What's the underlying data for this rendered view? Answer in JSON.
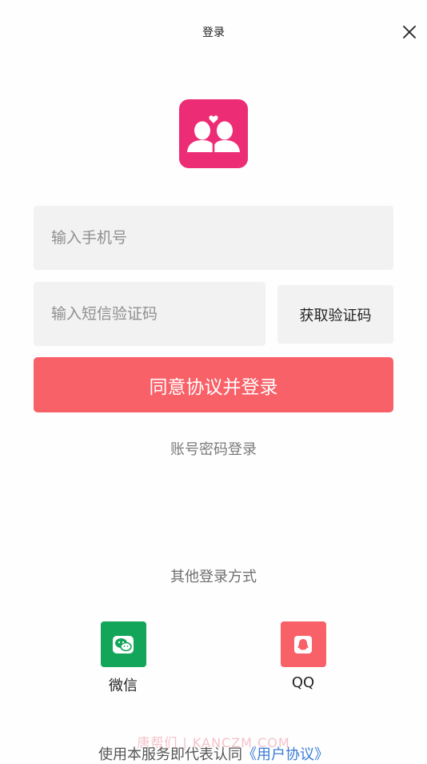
{
  "header": {
    "title": "登录"
  },
  "form": {
    "phone_placeholder": "输入手机号",
    "code_placeholder": "输入短信验证码",
    "get_code_label": "获取验证码",
    "login_label": "同意协议并登录"
  },
  "password_login_label": "账号密码登录",
  "other_login": {
    "label": "其他登录方式",
    "options": [
      {
        "label": "微信",
        "icon": "wechat-icon",
        "color": "#13a65a"
      },
      {
        "label": "QQ",
        "icon": "qq-icon",
        "color": "#f86168"
      }
    ]
  },
  "watermark": "唐帮们 | KANCZM.COM",
  "agreement": {
    "prefix": "使用本服务即代表认同",
    "link": "《用户协议》"
  },
  "colors": {
    "brand": "#ec2c74",
    "primary_button": "#f86168",
    "input_bg": "#f2f2f2",
    "link": "#3a7bd5"
  }
}
